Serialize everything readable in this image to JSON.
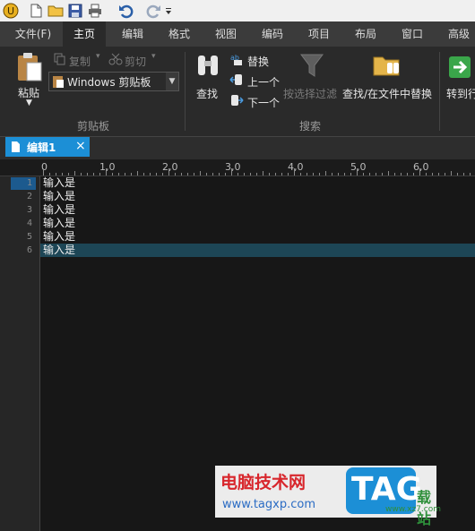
{
  "menu": {
    "tabs": [
      {
        "label": "文件(F)"
      },
      {
        "label": "主页"
      },
      {
        "label": "编辑"
      },
      {
        "label": "格式"
      },
      {
        "label": "视图"
      },
      {
        "label": "编码"
      },
      {
        "label": "项目"
      },
      {
        "label": "布局"
      },
      {
        "label": "窗口"
      },
      {
        "label": "高级"
      }
    ]
  },
  "ribbon": {
    "paste": "粘贴",
    "copy": "复制",
    "cut": "剪切",
    "clipboard_select": "Windows 剪贴板",
    "clipboard_group": "剪贴板",
    "find": "查找",
    "replace": "替换",
    "prev": "上一个",
    "next": "下一个",
    "filter": "按选择过滤",
    "find_in_files": "查找/在文件中替换",
    "goto": "转到行",
    "search_group": "搜索"
  },
  "document": {
    "tab_title": "编辑1",
    "close": "×"
  },
  "ruler": [
    "0",
    "1,0",
    "2,0",
    "3,0",
    "4,0",
    "5,0",
    "6,0"
  ],
  "editor": {
    "line_numbers": [
      "1",
      "2",
      "3",
      "4",
      "5",
      "6"
    ],
    "lines": [
      "输入是",
      "输入是",
      "输入是",
      "输入是",
      "输入是",
      "输入是"
    ],
    "current_line": 6
  },
  "watermark": {
    "site_name": "电脑技术网",
    "url": "www.tagxp.com",
    "logo": "TAG",
    "suffix": "载站",
    "suffix_url": "www.xz7.com"
  },
  "colors": {
    "accent": "#1c8fd6",
    "current_line": "#1d4656",
    "editor_bg": "#171717"
  }
}
